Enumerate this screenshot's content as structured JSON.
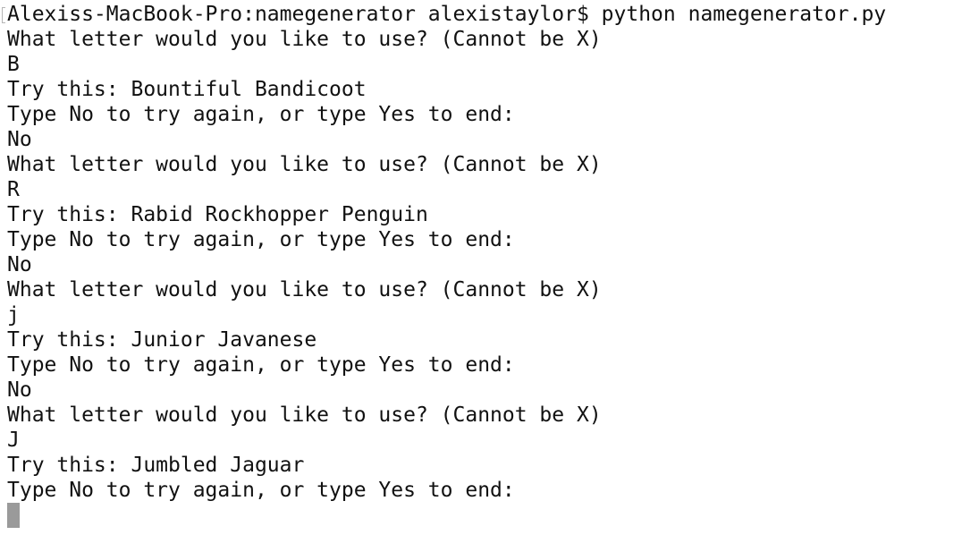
{
  "terminal": {
    "lines": [
      "Alexiss-MacBook-Pro:namegenerator alexistaylor$ python namegenerator.py",
      "What letter would you like to use? (Cannot be X)",
      "B",
      "Try this: Bountiful Bandicoot",
      "Type No to try again, or type Yes to end:",
      "No",
      "What letter would you like to use? (Cannot be X)",
      "R",
      "Try this: Rabid Rockhopper Penguin",
      "Type No to try again, or type Yes to end:",
      "No",
      "What letter would you like to use? (Cannot be X)",
      "j",
      "Try this: Junior Javanese",
      "Type No to try again, or type Yes to end:",
      "No",
      "What letter would you like to use? (Cannot be X)",
      "J",
      "Try this: Jumbled Jaguar",
      "Type No to try again, or type Yes to end:"
    ],
    "cursor_color": "#9a9a9a",
    "text_color": "#111111",
    "background_color": "#ffffff"
  }
}
